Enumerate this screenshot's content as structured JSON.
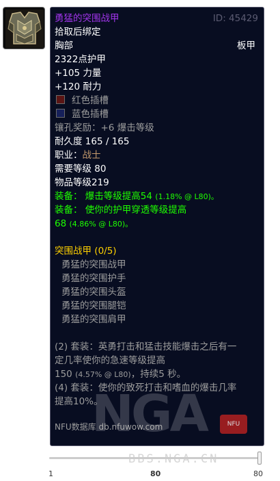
{
  "item": {
    "name": "勇猛的突围战甲",
    "id_label": "ID: 45429",
    "binding": "拾取后绑定",
    "slot": "胸部",
    "armor_type": "板甲",
    "armor": "2322点护甲",
    "stats": [
      "+105 力量",
      "+120 耐力"
    ],
    "sockets": [
      {
        "color": "red",
        "label": "红色插槽"
      },
      {
        "color": "blue",
        "label": "蓝色插槽"
      }
    ],
    "socket_bonus": "镶孔奖励：+6 爆击等级",
    "durability": "耐久度 165 / 165",
    "class_label": "职业：",
    "class_value": "战士",
    "required_level": "需要等级 80",
    "item_level": "物品等级219",
    "equip1_prefix": "装备：",
    "equip1_text": "爆击等级提高54",
    "equip1_small": "(1.18% @ L80)。",
    "equip2_prefix": "装备：",
    "equip2_text": "使你的护甲穿透等级提高",
    "equip2_line2": "68",
    "equip2_small": "(4.86% @ L80)。"
  },
  "set": {
    "title": "突围战甲",
    "count": "(0/5)",
    "pieces": [
      "勇猛的突围战甲",
      "勇猛的突围护手",
      "勇猛的突围头盔",
      "勇猛的突围腿铠",
      "勇猛的突围肩甲"
    ],
    "bonus2_line1": "(2) 套装：英勇打击和猛击技能爆击之后有一",
    "bonus2_line2": "定几率使你的急速等级提高",
    "bonus2_line3_value": "150",
    "bonus2_line3_small": "(4.57% @ L80)",
    "bonus2_line3_tail": "，持续5 秒。",
    "bonus4_line1": "(4) 套装：使你的致死打击和嗜血的爆击几率",
    "bonus4_line2": "提高10%。"
  },
  "footer": "NFU数据库 db.nfuwow.com",
  "watermark": {
    "text": "NGA",
    "badge": "NFU",
    "site": "BBS.NGA.CN"
  },
  "level_slider": {
    "min": "1",
    "current": "80",
    "max": "80",
    "value_fraction": 1.0
  },
  "colors": {
    "epic": "#a335ee",
    "uncommon": "#1eff00",
    "gold": "#ffd100",
    "warrior": "#c69b6d",
    "gray": "#9d9d9d",
    "tooltip_bg": "#080d21"
  },
  "icon": {
    "name": "plate-chest-armor-icon"
  }
}
